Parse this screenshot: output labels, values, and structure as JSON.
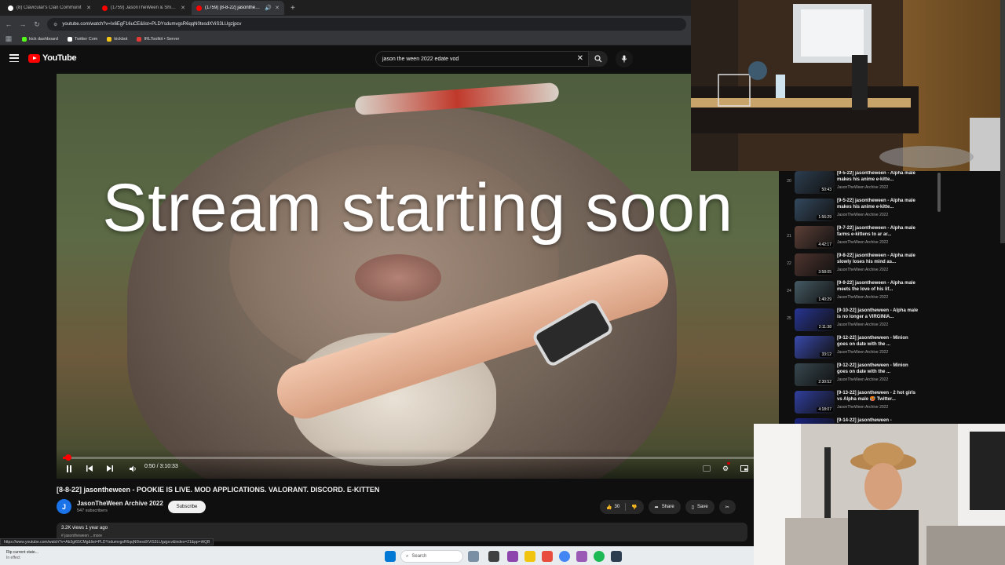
{
  "browser": {
    "tabs": [
      {
        "title": "(8) Clavicular's Clan Communit",
        "fav_color": "#ffffff",
        "active": false
      },
      {
        "title": "(1759) JasonTheWeen & Shizuk",
        "fav_color": "#ff0000",
        "active": false
      },
      {
        "title": "(1759) [8-8-22] jasontheween",
        "fav_color": "#ff0000",
        "active": true
      }
    ],
    "url": "youtube.com/watch?v=Ix6EgF16uCE&list=PLDYsdumvgsR6qqN0tesdXViS3LUgzjpcv",
    "bookmarks": [
      {
        "label": "kick dashboard",
        "color": "#53fc18"
      },
      {
        "label": "Twitter Com",
        "color": "#ffffff"
      },
      {
        "label": "kickbot",
        "color": "#f5c518"
      },
      {
        "label": "IRLToolkit • Server",
        "color": "#e53935"
      }
    ]
  },
  "youtube": {
    "logo_text": "YouTube",
    "search_value": "jason the ween 2022 edate vod"
  },
  "player": {
    "overlay_text": "Stream starting soon",
    "time_display": "0:50 / 3:10:33",
    "progress_fraction": 0.0044
  },
  "video": {
    "title": "[8-8-22] jasontheween - POOKIE IS LIVE. MOD APPLICATIONS. VALORANT. DISCORD. E-KITTEN",
    "channel_initial": "J",
    "channel_name": "JasonTheWeen Archive 2022",
    "subscribers": "547 subscribers",
    "subscribe_label": "Subscribe",
    "like_count": "30",
    "share_label": "Share",
    "save_label": "Save",
    "description_meta": "3.2K views  1 year ago",
    "description_more": "# jasontheween     ...more",
    "status_url": "https://www.youtube.com/watch?v=Ab3gI65CMg&list=PLDYsdumvgsR6qqN0tesdXViS3LUgzjpcv&index=21&pp=iAQB"
  },
  "playlist": [
    {
      "index": "20",
      "duration": "50:43",
      "title": "[9-5-22] jasontheween - Alpha male makes his anime e-kitte...",
      "channel": "JasonTheWeen Archive 2022",
      "thumb": "#2c3e50"
    },
    {
      "index": "",
      "duration": "1:56:29",
      "title": "[9-5-22] jasontheween - Alpha male makes his anime e-kitte...",
      "channel": "JasonTheWeen Archive 2022",
      "thumb": "#34495e"
    },
    {
      "index": "21",
      "duration": "4:42:17",
      "title": "[9-7-22] jasontheween - Alpha male farms e-kittens to ar ar...",
      "channel": "JasonTheWeen Archive 2022",
      "thumb": "#5d4037"
    },
    {
      "index": "22",
      "duration": "3:58:05",
      "title": "[9-8-22] jasontheween - Alpha male slowly loses his mind as...",
      "channel": "JasonTheWeen Archive 2022",
      "thumb": "#4e342e"
    },
    {
      "index": "24",
      "duration": "1:40:29",
      "title": "[9-9-22] jasontheween - Alpha male meets the love of his lif...",
      "channel": "JasonTheWeen Archive 2022",
      "thumb": "#455a64"
    },
    {
      "index": "25",
      "duration": "2:11:38",
      "title": "[9-10-22] jasontheween - Alpha male is no longer a VIRGINIA...",
      "channel": "JasonTheWeen Archive 2022",
      "thumb": "#283593"
    },
    {
      "index": "",
      "duration": "33:12",
      "title": "[9-12-22] jasontheween - Minion goes on date with the ...",
      "channel": "JasonTheWeen Archive 2022",
      "thumb": "#3949ab"
    },
    {
      "index": "",
      "duration": "2:30:52",
      "title": "[9-12-22] jasontheween - Minion goes on date with the ...",
      "channel": "JasonTheWeen Archive 2022",
      "thumb": "#37474f"
    },
    {
      "index": "",
      "duration": "4:18:07",
      "title": "[9-13-22] jasontheween - 2 hot girls vs Alpha male 🥵 Twitter...",
      "channel": "JasonTheWeen Archive 2022",
      "thumb": "#303f9f"
    },
    {
      "index": "",
      "duration": "",
      "title": "[9-14-22] jasontheween -",
      "channel": "",
      "thumb": "#1a237e"
    }
  ],
  "taskbar": {
    "weather_title": "Rip current state...",
    "weather_sub": "In effect",
    "search_label": "Search"
  }
}
